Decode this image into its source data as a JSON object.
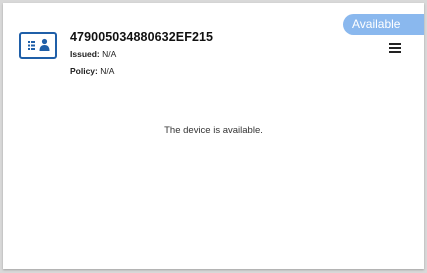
{
  "device": {
    "id": "479005034880632EF215",
    "issued_label": "Issued:",
    "issued_value": "N/A",
    "policy_label": "Policy:",
    "policy_value": "N/A",
    "icon": "id-card-icon"
  },
  "status": {
    "label": "Available",
    "color": "#8ab8ee"
  },
  "menu": {
    "icon": "hamburger-menu-icon"
  },
  "message": "The device is available.",
  "colors": {
    "accent": "#1f5fa8"
  }
}
